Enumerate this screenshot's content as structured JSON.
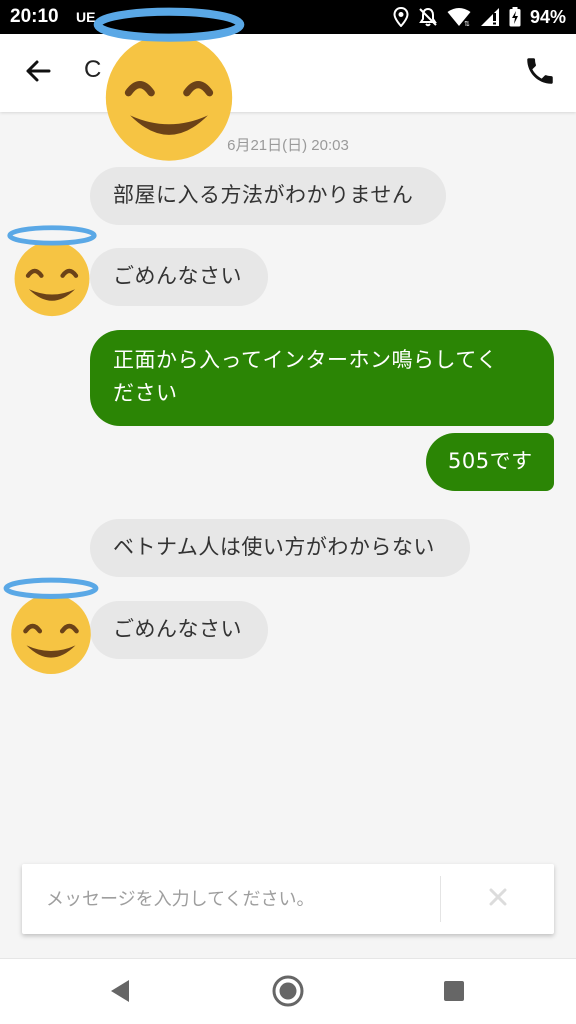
{
  "status_bar": {
    "time": "20:10",
    "carrier": "UE",
    "battery": "94%"
  },
  "header": {
    "title": "C",
    "back_icon": "arrow-left-icon",
    "call_icon": "phone-icon"
  },
  "chat": {
    "date_label": "6月21日(日) 20:03",
    "messages": [
      {
        "direction": "incoming",
        "text": "部屋に入る方法がわかりません"
      },
      {
        "direction": "incoming",
        "text": "ごめんなさい"
      },
      {
        "direction": "outgoing",
        "text_line1": "正面から入ってインターホン鳴らしてく",
        "text_line2": "ださい"
      },
      {
        "direction": "outgoing",
        "text": "505です"
      },
      {
        "direction": "incoming",
        "text": "ベトナム人は使い方がわからない"
      },
      {
        "direction": "incoming",
        "text": "ごめんなさい"
      }
    ]
  },
  "composer": {
    "placeholder": "メッセージを入力してください。",
    "send_icon": "close-icon"
  },
  "nav_bar": {
    "back_icon": "nav-back-icon",
    "home_icon": "nav-home-icon",
    "recents_icon": "nav-recents-icon"
  },
  "stickers": {
    "icon": "smiling-face-with-halo-icon"
  },
  "colors": {
    "outgoing_bubble": "#2b8505",
    "incoming_bubble": "#e7e7e7",
    "background": "#f5f5f5",
    "halo": "#5aa8e6",
    "emoji_face": "#f6c443"
  }
}
